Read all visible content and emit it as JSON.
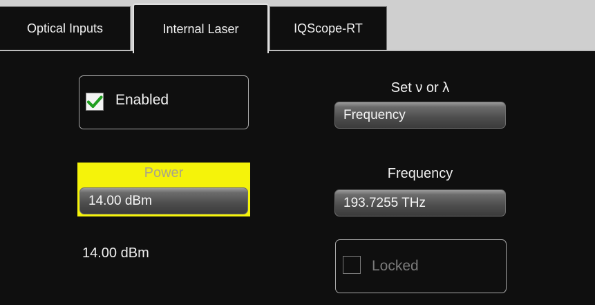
{
  "tabs": [
    {
      "label": "Optical Inputs",
      "active": false
    },
    {
      "label": "Internal Laser",
      "active": true
    },
    {
      "label": "IQScope-RT",
      "active": false
    }
  ],
  "enabled": {
    "label": "Enabled",
    "checked": true
  },
  "set_mode": {
    "title": "Set ν or λ",
    "value": "Frequency"
  },
  "power": {
    "title": "Power",
    "value": "14.00 dBm",
    "readout": "14.00 dBm",
    "highlight_color": "#f5f30a"
  },
  "frequency": {
    "title": "Frequency",
    "value": "193.7255 THz"
  },
  "locked": {
    "label": "Locked",
    "checked": false,
    "disabled": true
  },
  "colors": {
    "check_green": "#1f9e1f",
    "panel_bg": "#0f0f0f"
  }
}
